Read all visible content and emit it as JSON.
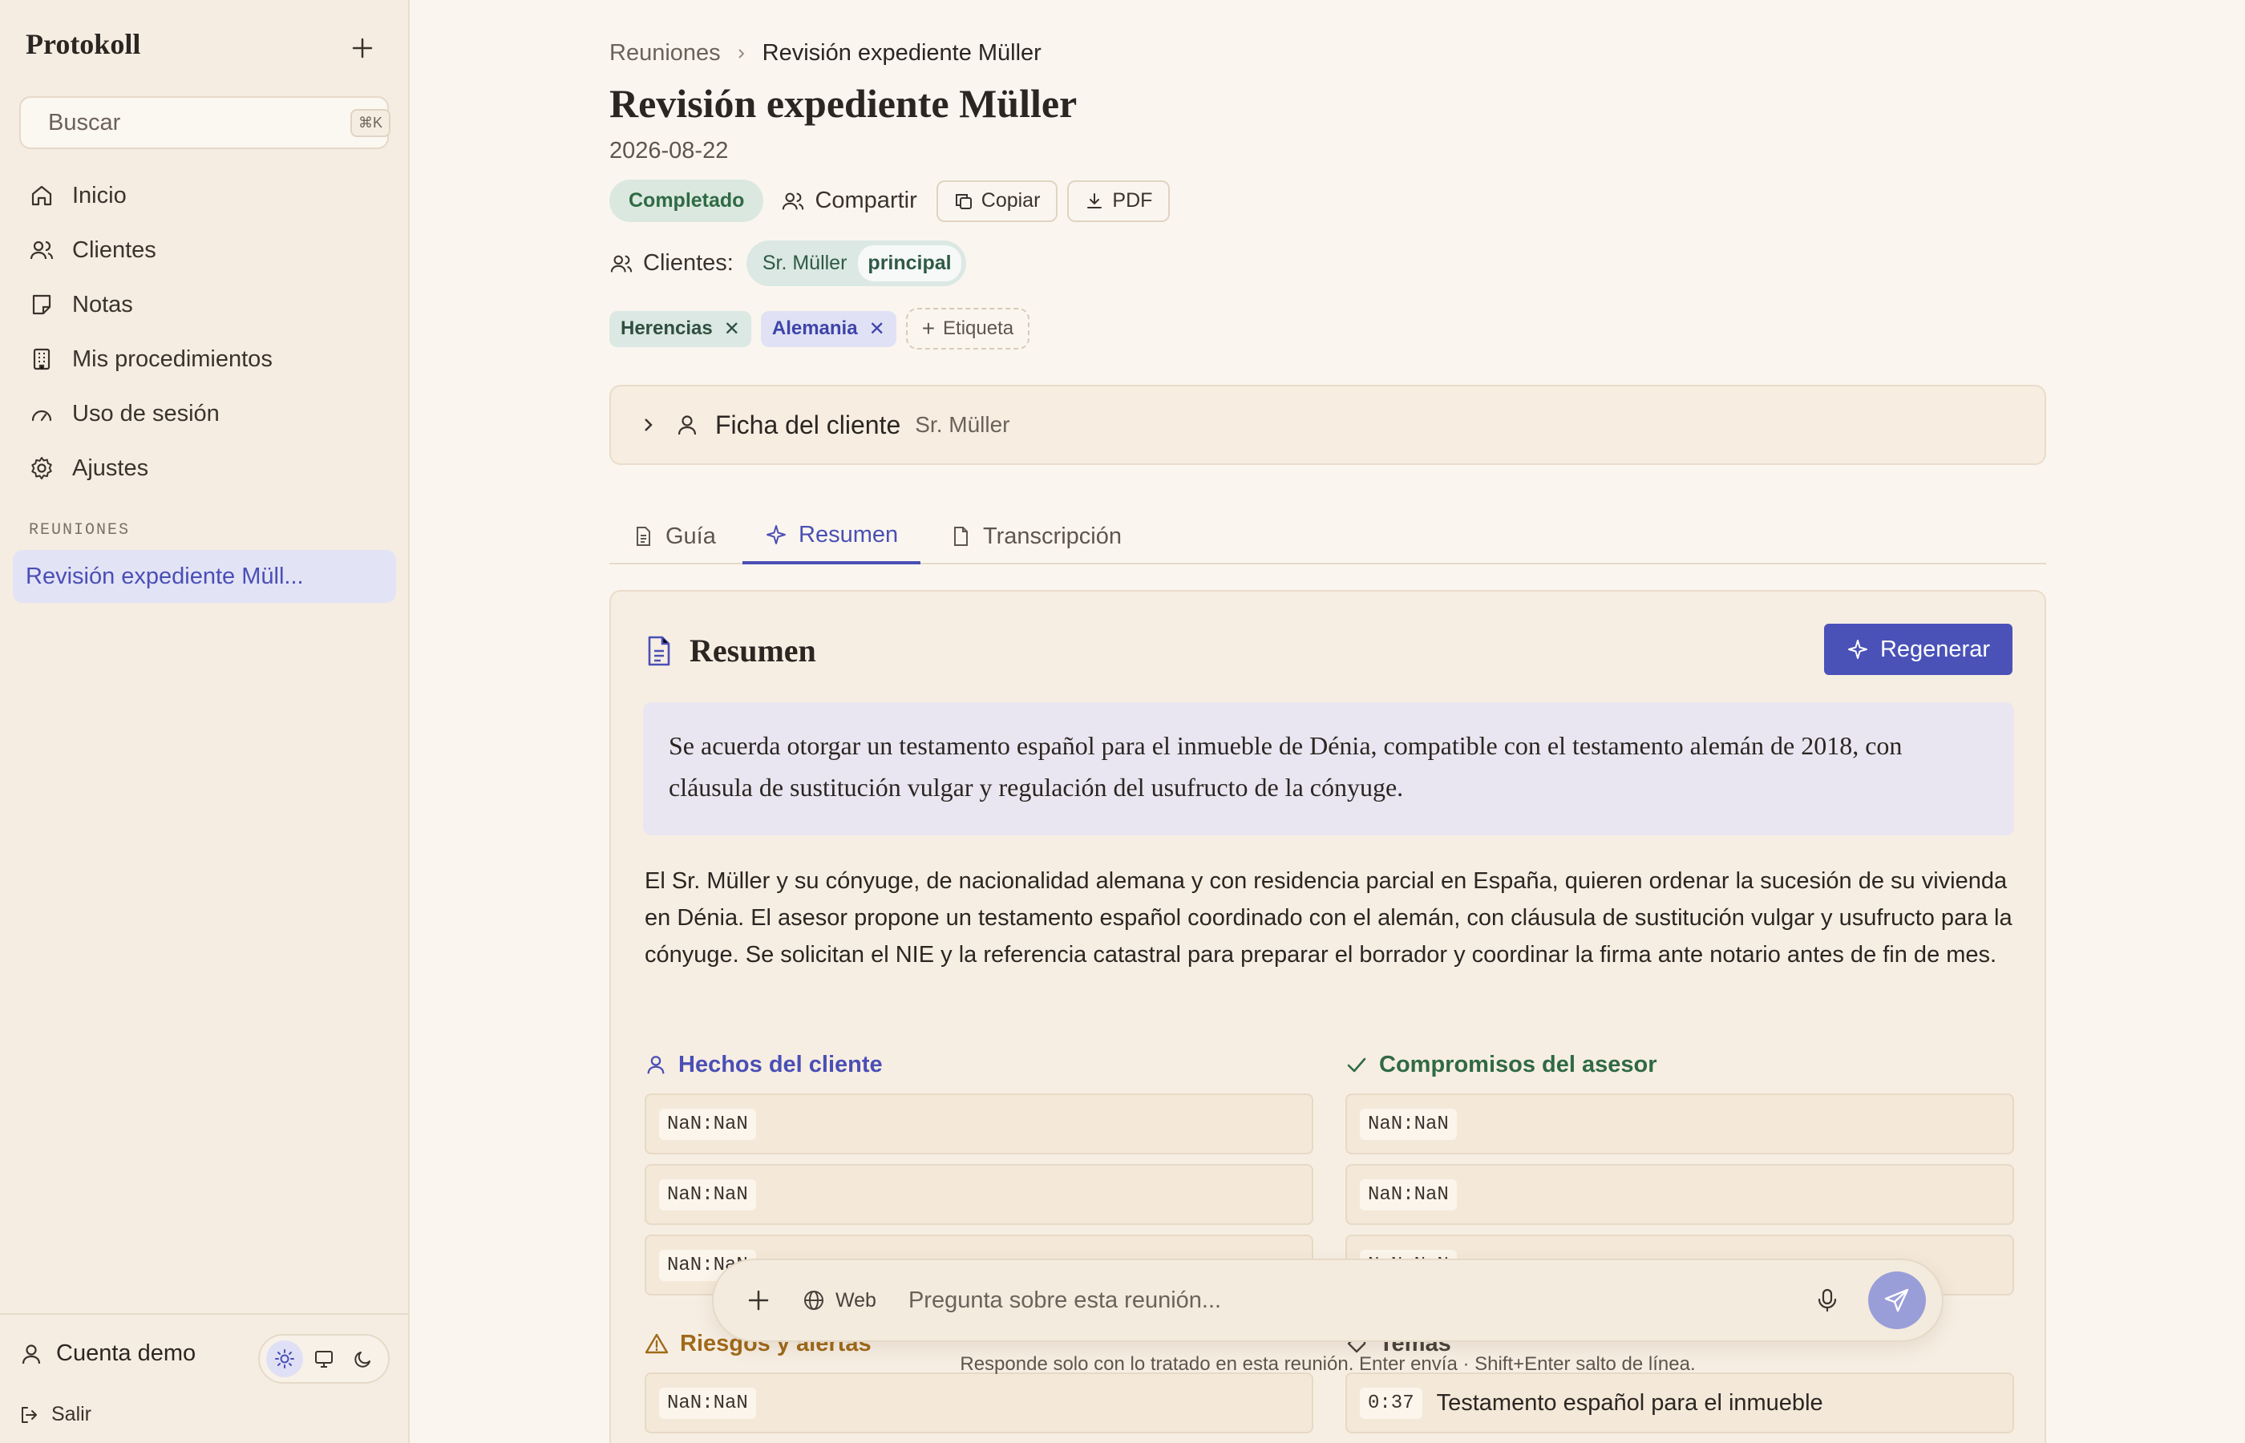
{
  "sidebar": {
    "brand": "Protokoll",
    "search": {
      "placeholder": "Buscar",
      "shortcut": "⌘K"
    },
    "items": [
      {
        "label": "Inicio",
        "icon": "home-icon"
      },
      {
        "label": "Clientes",
        "icon": "users-icon"
      },
      {
        "label": "Notas",
        "icon": "note-icon"
      },
      {
        "label": "Mis procedimientos",
        "icon": "building-icon"
      },
      {
        "label": "Uso de sesión",
        "icon": "gauge-icon"
      },
      {
        "label": "Ajustes",
        "icon": "gear-icon"
      }
    ],
    "section_label": "REUNIONES",
    "active_meeting": "Revisión expediente Müll...",
    "account": "Cuenta demo",
    "logout": "Salir"
  },
  "header": {
    "breadcrumb_root": "Reuniones",
    "breadcrumb_current": "Revisión expediente Müller",
    "title": "Revisión expediente Müller",
    "date": "2026-08-22",
    "status": "Completado",
    "share_label": "Compartir",
    "copy_label": "Copiar",
    "pdf_label": "PDF",
    "clients_label": "Clientes:",
    "client_name": "Sr. Müller",
    "client_role": "principal",
    "tags": [
      "Herencias",
      "Alemania"
    ],
    "add_tag_label": "Etiqueta"
  },
  "client_card": {
    "title": "Ficha del cliente",
    "subtitle": "Sr. Müller"
  },
  "tabs": [
    {
      "label": "Guía"
    },
    {
      "label": "Resumen"
    },
    {
      "label": "Transcripción"
    }
  ],
  "summary": {
    "title": "Resumen",
    "regenerate_label": "Regenerar",
    "highlight": "Se acuerda otorgar un testamento español para el inmueble de Dénia, compatible con el testamento alemán de 2018, con cláusula de sustitución vulgar y regulación del usufructo de la cónyuge.",
    "body": "El Sr. Müller y su cónyuge, de nacionalidad alemana y con residencia parcial en España, quieren ordenar la sucesión de su vivienda en Dénia. El asesor propone un testamento español coordinado con el alemán, con cláusula de sustitución vulgar y usufructo para la cónyuge. Se solicitan el NIE y la referencia catastral para preparar el borrador y coordinar la firma ante notario antes de fin de mes.",
    "facts_title": "Hechos del cliente",
    "facts": [
      "NaN:NaN",
      "NaN:NaN",
      "NaN:NaN"
    ],
    "commitments_title": "Compromisos del asesor",
    "commitments": [
      "NaN:NaN",
      "NaN:NaN",
      "NaN:NaN"
    ],
    "risks_title": "Riesgos y alertas",
    "risks": [
      "NaN:NaN"
    ],
    "topics_title": "Temas",
    "topics": [
      {
        "time": "0:37",
        "text": "Testamento español para el inmueble"
      }
    ]
  },
  "chat": {
    "web_label": "Web",
    "placeholder": "Pregunta sobre esta reunión...",
    "hint": "Responde solo con lo tratado en esta reunión. Enter envía · Shift+Enter salto de línea."
  },
  "colors": {
    "accent": "#4a52b8",
    "facts": "#4a4fb5",
    "commitments": "#2f6a44",
    "risks": "#a06a1a"
  }
}
